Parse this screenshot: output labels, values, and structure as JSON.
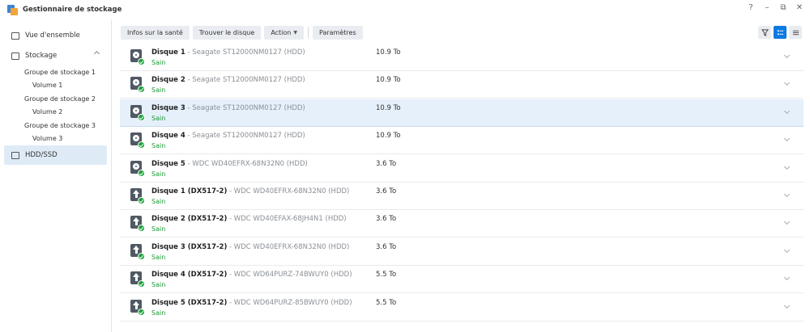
{
  "app": {
    "title": "Gestionnaire de stockage",
    "controls": [
      "?",
      "–",
      "⧉",
      "✕"
    ]
  },
  "sidebar": {
    "overview": "Vue d'ensemble",
    "storage": "Stockage",
    "groups": [
      {
        "label": "Groupe de stockage 1",
        "volume": "Volume 1"
      },
      {
        "label": "Groupe de stockage 2",
        "volume": "Volume 2"
      },
      {
        "label": "Groupe de stockage 3",
        "volume": "Volume 3"
      }
    ],
    "hdd": "HDD/SSD"
  },
  "toolbar": {
    "health": "Infos sur la santé",
    "find": "Trouver le disque",
    "action": "Action",
    "settings": "Paramètres"
  },
  "disks": [
    {
      "name": "Disque 1",
      "model": " - Seagate ST12000NM0127 (HDD)",
      "status": "Sain",
      "size": "10.9 To",
      "type": "internal"
    },
    {
      "name": "Disque 2",
      "model": " - Seagate ST12000NM0127 (HDD)",
      "status": "Sain",
      "size": "10.9 To",
      "type": "internal"
    },
    {
      "name": "Disque 3",
      "model": " - Seagate ST12000NM0127 (HDD)",
      "status": "Sain",
      "size": "10.9 To",
      "type": "internal"
    },
    {
      "name": "Disque 4",
      "model": " - Seagate ST12000NM0127 (HDD)",
      "status": "Sain",
      "size": "10.9 To",
      "type": "internal"
    },
    {
      "name": "Disque 5",
      "model": " - WDC WD40EFRX-68N32N0 (HDD)",
      "status": "Sain",
      "size": "3.6 To",
      "type": "internal"
    },
    {
      "name": "Disque 1 (DX517-2)",
      "model": " - WDC WD40EFRX-68N32N0 (HDD)",
      "status": "Sain",
      "size": "3.6 To",
      "type": "expansion"
    },
    {
      "name": "Disque 2 (DX517-2)",
      "model": " - WDC WD40EFAX-68JH4N1 (HDD)",
      "status": "Sain",
      "size": "3.6 To",
      "type": "expansion"
    },
    {
      "name": "Disque 3 (DX517-2)",
      "model": " - WDC WD40EFRX-68N32N0 (HDD)",
      "status": "Sain",
      "size": "3.6 To",
      "type": "expansion"
    },
    {
      "name": "Disque 4 (DX517-2)",
      "model": " - WDC WD64PURZ-74BWUY0 (HDD)",
      "status": "Sain",
      "size": "5.5 To",
      "type": "expansion"
    },
    {
      "name": "Disque 5 (DX517-2)",
      "model": " - WDC WD64PURZ-85BWUY0 (HDD)",
      "status": "Sain",
      "size": "5.5 To",
      "type": "expansion"
    }
  ],
  "selected_disk_index": 2,
  "colors": {
    "accent": "#0c7ae0",
    "healthy": "#1a9a33",
    "selected_row": "#e6f0fa"
  }
}
